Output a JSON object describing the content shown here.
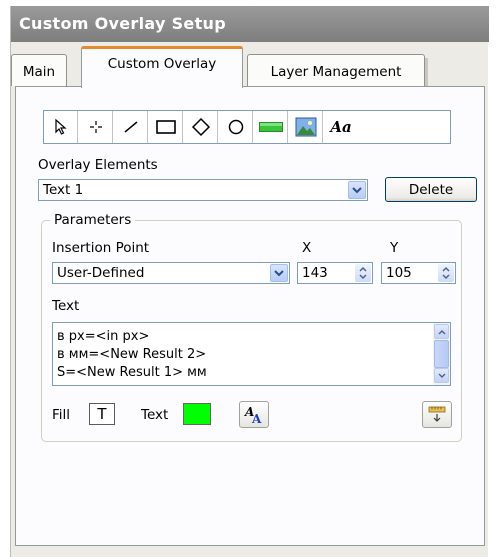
{
  "window": {
    "title": "Custom Overlay Setup"
  },
  "tabs": [
    {
      "label": "Main",
      "active": false
    },
    {
      "label": "Custom Overlay",
      "active": true
    },
    {
      "label": "Layer Management",
      "active": false
    }
  ],
  "toolbar": {
    "tools": [
      "select-arrow-icon",
      "crosshair-icon",
      "line-icon",
      "rectangle-icon",
      "diamond-icon",
      "ellipse-icon",
      "color-bar-icon",
      "image-icon",
      "text-tool-icon"
    ],
    "text_tool_glyph": "Aa"
  },
  "overlay_elements": {
    "label": "Overlay Elements",
    "selected": "Text 1",
    "delete_label": "Delete"
  },
  "parameters": {
    "title": "Parameters",
    "insertion_point": {
      "label": "Insertion Point",
      "selected": "User-Defined"
    },
    "x": {
      "label": "X",
      "value": "143"
    },
    "y": {
      "label": "Y",
      "value": "105"
    },
    "text": {
      "label": "Text",
      "lines": [
        "в px=<in px>",
        "в мм=<New Result 2>",
        "S=<New Result 1> мм"
      ]
    },
    "fill": {
      "label": "Fill",
      "glyph": "T"
    },
    "text_color": {
      "label": "Text",
      "color": "#00ff00"
    },
    "font_button_glyph": "A"
  },
  "colors": {
    "accent_tab": "#e68b2c",
    "title_bar": "#8c8c8c",
    "text_color_swatch": "#00ff00"
  }
}
